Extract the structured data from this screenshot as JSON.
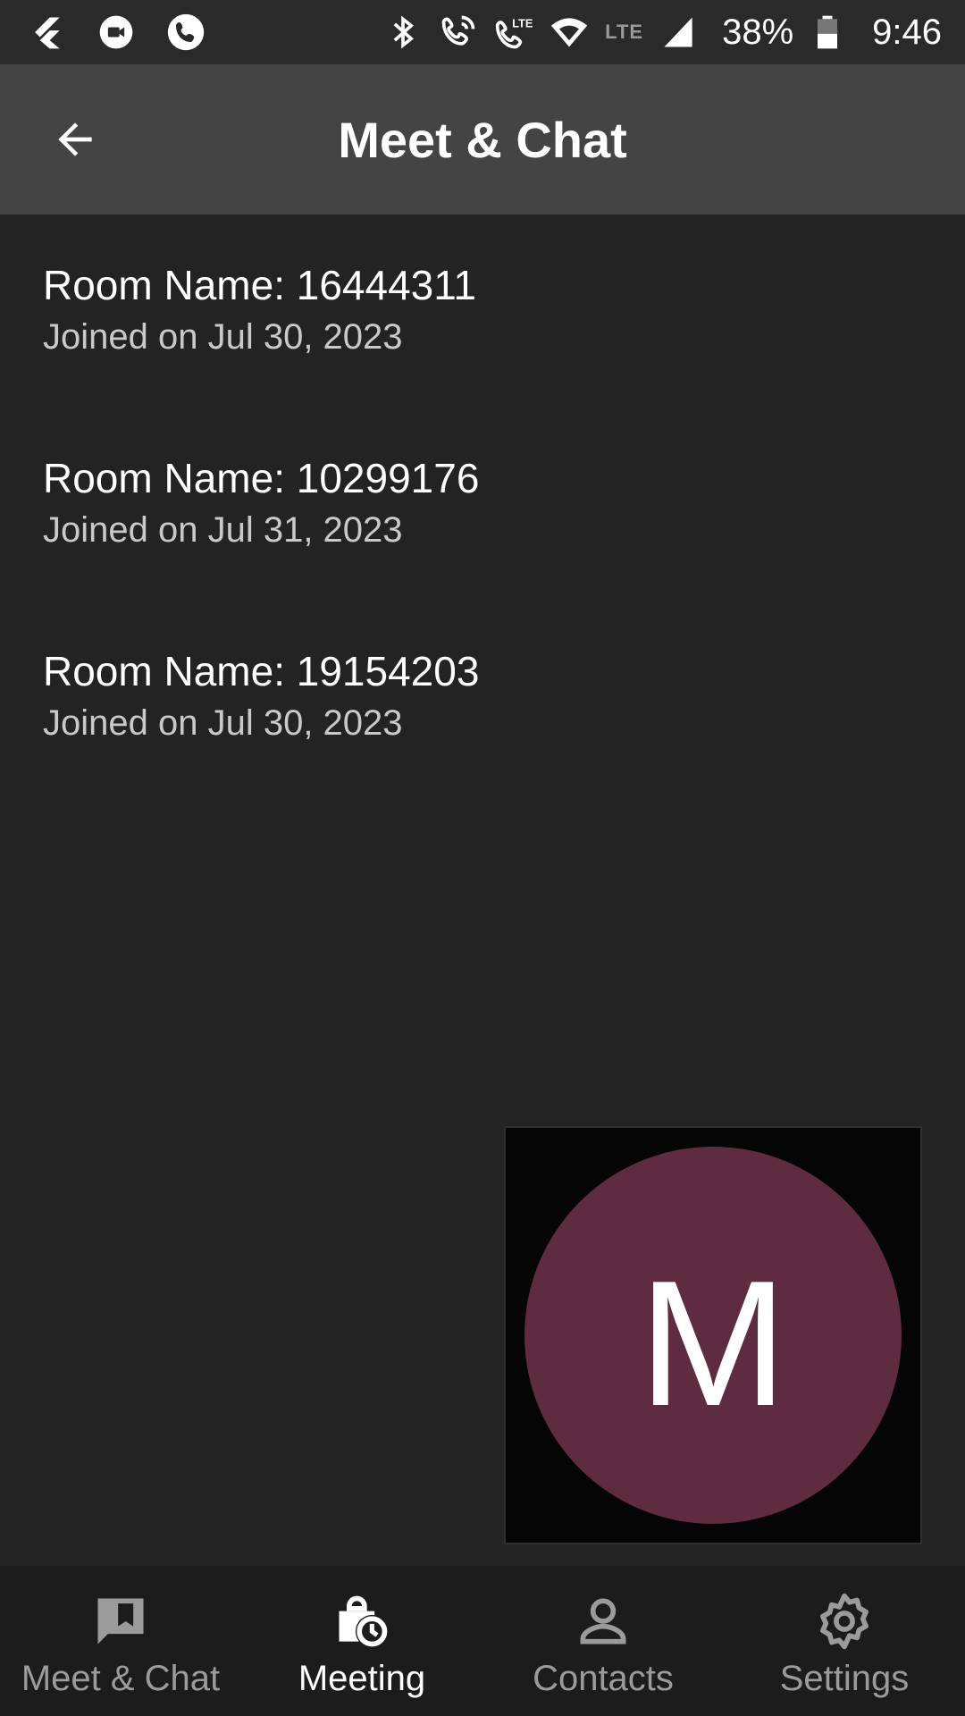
{
  "status_bar": {
    "lte_label": "LTE",
    "battery_percent": "38%",
    "time": "9:46"
  },
  "app_bar": {
    "title": "Meet & Chat"
  },
  "rooms": [
    {
      "name": "Room Name: 16444311",
      "joined": "Joined on Jul 30, 2023"
    },
    {
      "name": "Room Name: 10299176",
      "joined": "Joined on Jul 31, 2023"
    },
    {
      "name": "Room Name: 19154203",
      "joined": "Joined on Jul 30, 2023"
    }
  ],
  "self_view": {
    "avatar_letter": "M",
    "avatar_color": "#5e2b40"
  },
  "bottom_nav": {
    "items": [
      {
        "label": "Meet & Chat",
        "icon": "chat-bookmark-icon",
        "active": false
      },
      {
        "label": "Meeting",
        "icon": "bag-clock-icon",
        "active": true
      },
      {
        "label": "Contacts",
        "icon": "person-icon",
        "active": false
      },
      {
        "label": "Settings",
        "icon": "gear-icon",
        "active": false
      }
    ]
  }
}
